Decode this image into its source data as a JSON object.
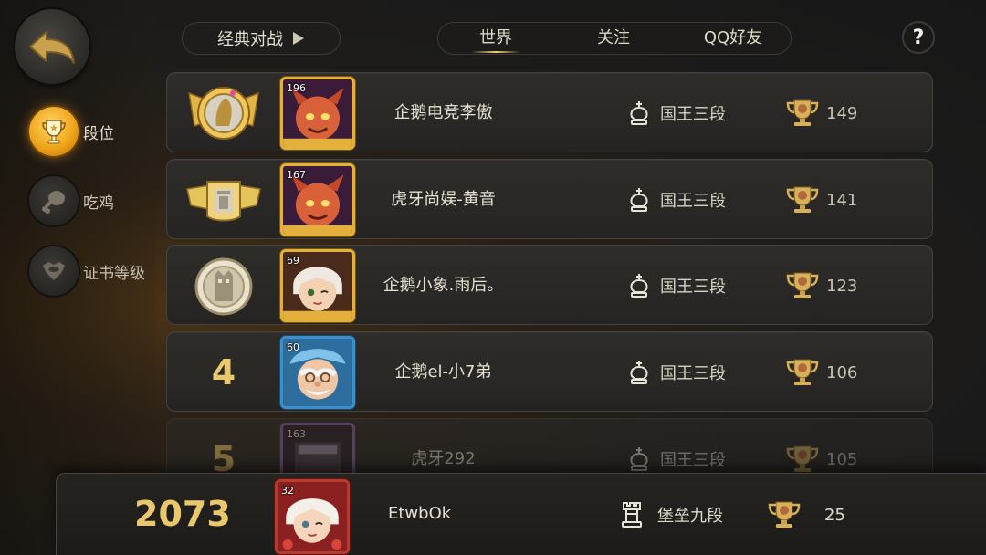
{
  "mode_selector": {
    "label": "经典对战",
    "icon": "triangle-right-icon"
  },
  "tabs": [
    {
      "label": "世界",
      "active": true
    },
    {
      "label": "关注",
      "active": false
    },
    {
      "label": "QQ好友",
      "active": false
    }
  ],
  "help": {
    "label": "?"
  },
  "sidebar": {
    "items": [
      {
        "label": "段位",
        "icon": "trophy-icon",
        "active": true
      },
      {
        "label": "吃鸡",
        "icon": "drumstick-icon",
        "active": false
      },
      {
        "label": "证书等级",
        "icon": "certificate-icon",
        "active": false
      }
    ]
  },
  "rankings": [
    {
      "rank": "1",
      "rank_icon": "gold-lion-badge-icon",
      "level": "196",
      "name": "企鹅电竞李傲",
      "title": "国王三段",
      "title_icon": "king-chess-icon",
      "trophies": "149"
    },
    {
      "rank": "2",
      "rank_icon": "silver-rook-badge-icon",
      "level": "167",
      "name": "虎牙尚娱-黄音",
      "title": "国王三段",
      "title_icon": "king-chess-icon",
      "trophies": "141"
    },
    {
      "rank": "3",
      "rank_icon": "bronze-knight-badge-icon",
      "level": "69",
      "name": "企鹅小象.雨后。",
      "title": "国王三段",
      "title_icon": "king-chess-icon",
      "trophies": "123"
    },
    {
      "rank": "4",
      "level": "60",
      "name": "企鹅el-小7弟",
      "title": "国王三段",
      "title_icon": "king-chess-icon",
      "trophies": "106"
    },
    {
      "rank": "5",
      "level": "163",
      "name": "虎牙292",
      "title": "国王三段",
      "title_icon": "king-chess-icon",
      "trophies": "105"
    }
  ],
  "self": {
    "rank": "2073",
    "level": "32",
    "name": "EtwbOk",
    "title": "堡垒九段",
    "title_icon": "rook-chess-icon",
    "trophies": "25"
  },
  "colors": {
    "accent_gold": "#e8c86a",
    "active_orange": "#f0a51b"
  }
}
